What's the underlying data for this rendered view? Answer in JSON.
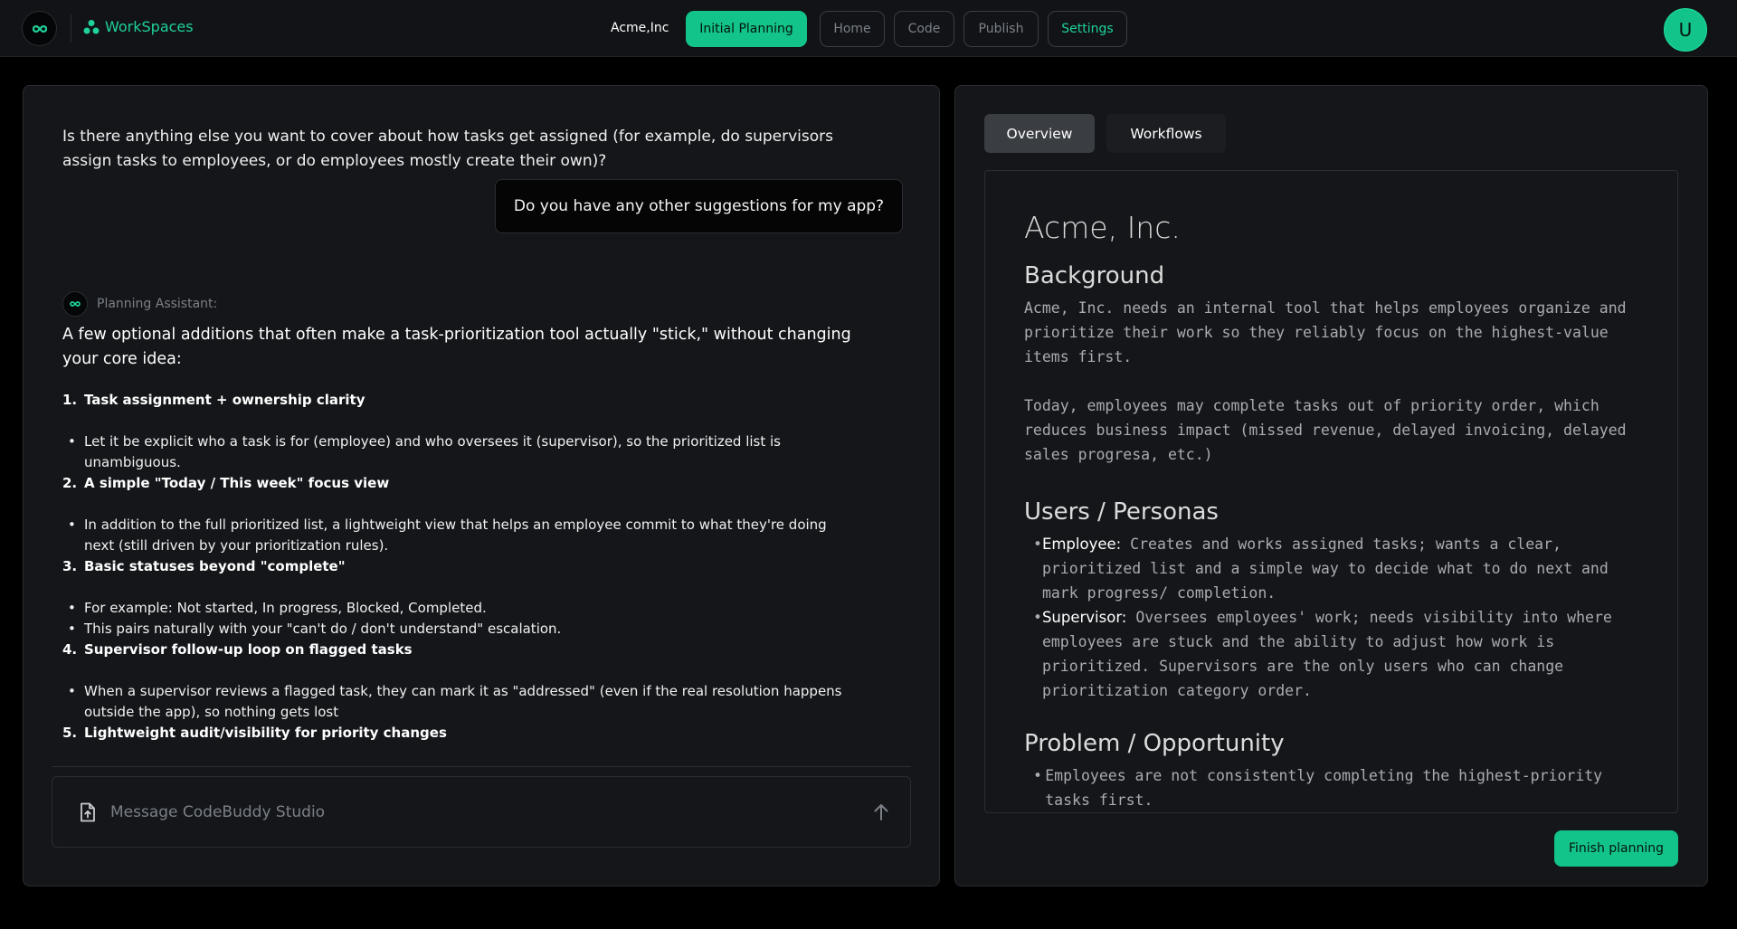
{
  "header": {
    "brand": "WorkSpaces",
    "company": "Acme,Inc",
    "nav": [
      "Initial Planning",
      "Home",
      "Code",
      "Publish",
      "Settings"
    ],
    "avatar_initial": "U"
  },
  "chat": {
    "question": "Is there anything else you want to cover about how tasks get assigned (for example, do supervisors assign tasks to employees, or do employees mostly create their own)?",
    "user_message": "Do you have any other suggestions for my app?",
    "assistant_label": "Planning Assistant:",
    "assistant_intro": "A few optional additions that often make a task-prioritization tool actually \"stick,\" without changing your core idea:",
    "suggestions": [
      {
        "num": "1.",
        "title": "Task assignment + ownership clarity",
        "bullets": [
          "Let it be explicit who a task is for (employee) and who oversees it (supervisor), so the prioritized list is unambiguous."
        ]
      },
      {
        "num": "2.",
        "title": "A simple \"Today / This week\" focus view",
        "bullets": [
          "In addition to the full prioritized list, a lightweight view that helps an employee commit to what they're doing next (still driven by your prioritization rules)."
        ]
      },
      {
        "num": "3.",
        "title": "Basic statuses beyond \"complete\"",
        "bullets": [
          "For example: Not started, In progress, Blocked, Completed.",
          "This pairs naturally with your \"can't do / don't understand\" escalation."
        ]
      },
      {
        "num": "4.",
        "title": "Supervisor follow-up loop on flagged tasks",
        "bullets": [
          "When a supervisor reviews a flagged task, they can mark it as \"addressed\" (even if the real resolution happens outside the app), so nothing gets lost"
        ]
      },
      {
        "num": "5.",
        "title": "Lightweight audit/visibility for priority changes",
        "bullets": []
      }
    ],
    "input_placeholder": "Message CodeBuddy Studio"
  },
  "doc_panel": {
    "tabs": [
      "Overview",
      "Workflows"
    ],
    "title": "Acme, Inc.",
    "background_heading": "Background",
    "background_p1": "Acme, Inc. needs an internal tool that helps employees organize and prioritize their work so they reliably focus on the highest-value items first.",
    "background_p2": "Today, employees may complete tasks out of priority order, which reduces business impact (missed revenue, delayed invoicing, delayed sales progresa, etc.)",
    "personas_heading": "Users / Personas",
    "personas": [
      {
        "label": "Employee:",
        "text": "Creates and works assigned tasks; wants a clear, prioritized list and a simple way to decide what to do next and mark progress/ completion."
      },
      {
        "label": "Supervisor:",
        "text": "Oversees employees' work; needs visibility into where employees are stuck and the ability to adjust how work is prioritized. Supervisors are the only users who can change prioritization category order."
      }
    ],
    "problem_heading": "Problem / Opportunity",
    "problems": [
      "Employees are not consistently completing the highest-priority tasks first."
    ],
    "finish_label": "Finish planning"
  },
  "colors": {
    "accent": "#12c489",
    "background": "#000000",
    "panel": "#141619"
  },
  "icons": [
    "logo-icon",
    "workspaces-icon",
    "file-upload-icon",
    "send-arrow-icon"
  ]
}
